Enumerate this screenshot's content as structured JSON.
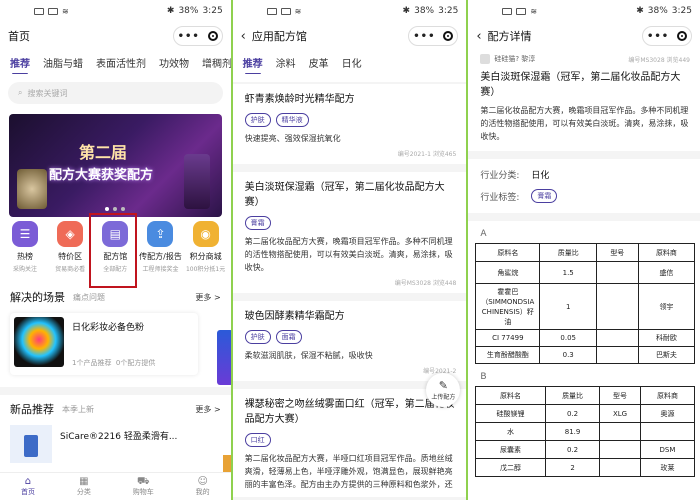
{
  "status": {
    "battery": "38%",
    "time": "3:25"
  },
  "panel1": {
    "title": "首页",
    "tabs": [
      "推荐",
      "油脂与蜡",
      "表面活性剂",
      "功效物",
      "增稠剂",
      "颜"
    ],
    "search_placeholder": "搜索关键词",
    "banner": {
      "line1": "第二届",
      "line2": "配方大赛获奖配方"
    },
    "categories": [
      {
        "label": "热榜",
        "sub": "采购关注",
        "icon": "hot-icon",
        "color": "#7b5cd6"
      },
      {
        "label": "特价区",
        "sub": "贸易商必看",
        "icon": "tag-icon",
        "color": "#ef6b57"
      },
      {
        "label": "配方馆",
        "sub": "全部配方",
        "icon": "formula-icon",
        "color": "#7c6ad8"
      },
      {
        "label": "传配方/报告",
        "sub": "工程师接奖金",
        "icon": "upload-icon",
        "color": "#4a8be0"
      },
      {
        "label": "积分商城",
        "sub": "100积分抵1元",
        "icon": "points-icon",
        "color": "#f0b233"
      }
    ],
    "scenes": {
      "title": "解决的场景",
      "subtitle": "痛点问题",
      "more": "更多 >",
      "card_name": "日化彩妆必备色粉",
      "card_meta1": "1个产品推荐",
      "card_meta2": "0个配方提供"
    },
    "new": {
      "title": "新品推荐",
      "subtitle": "本季上新",
      "more": "更多 >",
      "card_name": "SiCare®2216 轻盈柔滑有..."
    },
    "bottom_nav": [
      {
        "label": "首页",
        "icon": "home-icon"
      },
      {
        "label": "分类",
        "icon": "category-icon"
      },
      {
        "label": "购物车",
        "icon": "cart-icon"
      },
      {
        "label": "我的",
        "icon": "profile-icon"
      }
    ]
  },
  "panel2": {
    "title": "应用配方馆",
    "tabs": [
      "推荐",
      "涂料",
      "皮革",
      "日化"
    ],
    "formulas": [
      {
        "title": "虾青素焕龄时光精华配方",
        "tags": [
          "护肤",
          "精华液"
        ],
        "desc": "快速提亮、强效保湿抗氧化",
        "meta": "编号2021-1  浏览465"
      },
      {
        "title": "美白淡斑保湿霜（冠军，第二届化妆品配方大赛）",
        "tags": [
          "膏霜"
        ],
        "desc": "第二届化妆品配方大赛，晚霜项目冠军作品。多种不同机理的活性物搭配使用，可以有效美白淡斑。清爽，易涂抹，吸收快。",
        "meta": "编号MS3028  浏览448"
      },
      {
        "title": "玻色因酵素精华霜配方",
        "tags": [
          "护肤",
          "面霜"
        ],
        "desc": "柔软滋润肌肤，保湿不粘腻，吸收快",
        "meta": "编号2021-2"
      },
      {
        "title": "裸瑟秘密之吻丝绒雾面口红（冠军，第二届化妆品配方大赛）",
        "tags": [
          "口红"
        ],
        "desc": "第二届化妆品配方大赛，半哑口红项目冠军作品。质地丝绒爽滑，轻薄易上色，半哑浮雕外观，饱满显色，展现鲜艳亮丽的丰富色泽。配方由主办方提供的三种原料和色浆外，还"
      }
    ],
    "upload": "上传配方"
  },
  "panel3": {
    "title": "配方详情",
    "author": "硅硅猫? 黎淳",
    "code": "编号MS3028  浏览449",
    "name": "美白淡斑保湿霜（冠军，第二届化妆品配方大赛）",
    "desc": "第二届化妆品配方大赛，晚霜项目冠军作品。多种不同机理的活性物搭配使用，可以有效美白淡斑。清爽，易涂抹，吸收快。",
    "industry_label": "行业分类:",
    "industry_value": "日化",
    "tag_label": "行业标签:",
    "tag_value": "膏霜",
    "headers": [
      "原料名",
      "质量比",
      "型号",
      "原料商"
    ],
    "phaseA_label": "A",
    "phaseA": [
      [
        "角鲨烷",
        "1.5",
        "",
        "盛信"
      ],
      [
        "霍霍巴（SIMMONDSIA CHINENSIS）籽油",
        "1",
        "",
        "领宇"
      ],
      [
        "CI 77499",
        "0.05",
        "",
        "科耐欧"
      ],
      [
        "生育酚醋酸酯",
        "0.3",
        "",
        "巴斯夫"
      ]
    ],
    "phaseB_label": "B",
    "phaseB": [
      [
        "硅酸镁锂",
        "0.2",
        "XLG",
        "奥源"
      ],
      [
        "水",
        "81.9",
        "",
        ""
      ],
      [
        "尿囊素",
        "0.2",
        "",
        "DSM"
      ],
      [
        "戊二醇",
        "2",
        "",
        "玫莱"
      ]
    ]
  }
}
